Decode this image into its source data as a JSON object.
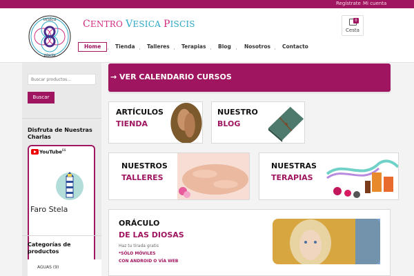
{
  "topbar": {
    "register": "Regístrate",
    "account": "Mi cuenta",
    "color": "#a0155f"
  },
  "brand": {
    "part1": "C",
    "part2": "ENTRO ",
    "part3": "V",
    "part4": "ESICA ",
    "part5": "P",
    "part6": "ISCIS",
    "logo_text_top": "vesica",
    "logo_text_bottom": "piscis"
  },
  "cart": {
    "label": "Cesta",
    "count": "0",
    "icon": "shopping-bag-icon"
  },
  "nav": {
    "items": [
      "Home",
      "Tienda",
      "Talleres",
      "Terapias",
      "Blog",
      "Nosotros",
      "Contacto"
    ],
    "active": "Home"
  },
  "sidebar": {
    "search_placeholder": "Buscar productos…",
    "search_button": "Buscar",
    "charlas_heading": "Disfruta de Nuestras Charlas",
    "youtube_label": "YouTube",
    "youtube_sup": "ES",
    "faro_text": "Faro Stela",
    "categories_heading": "Categorías de productos",
    "categories": [
      {
        "label": "AGUAS (9)"
      }
    ]
  },
  "main": {
    "banner": "→ VER CALENDARIO CURSOS",
    "cards": {
      "articulos": {
        "line1": "ARTÍCULOS",
        "line2": "TIENDA"
      },
      "blog": {
        "line1": "NUESTRO",
        "line2": "BLOG"
      },
      "talleres": {
        "line1": "NUESTROS",
        "line2": "TALLERES"
      },
      "terapias": {
        "line1": "NUESTRAS",
        "line2": "TERAPIAS"
      },
      "oraculo": {
        "line1": "ORÁCULO",
        "line2": "DE LAS DIOSAS",
        "sub": "Haz tu tirada gratis",
        "sub2": "*SÓLO MÓVILES",
        "sub3": "CON ANDROID O VÍA WEB"
      }
    }
  }
}
